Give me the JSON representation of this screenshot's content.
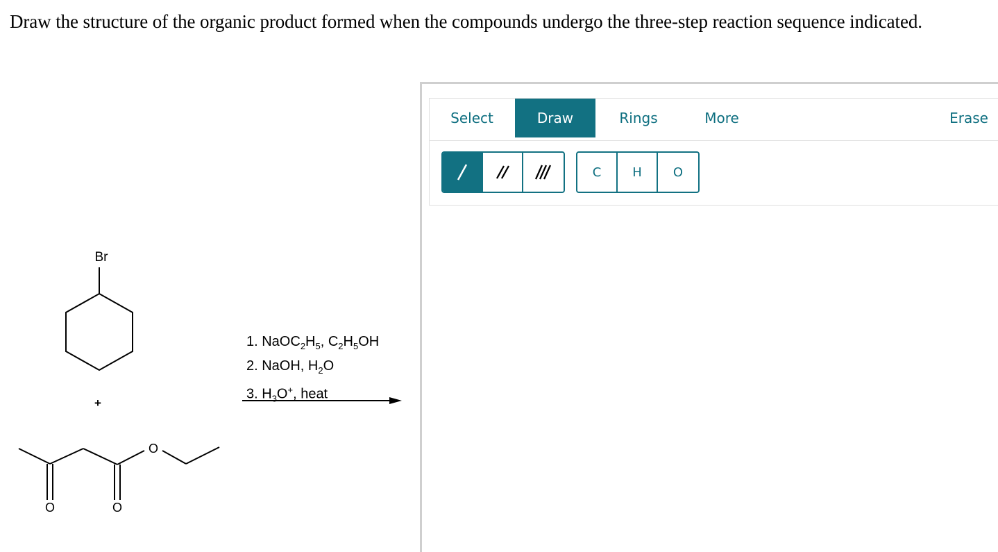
{
  "question": "Draw the structure of the organic product formed when the compounds undergo the three-step reaction sequence indicated.",
  "reactants": {
    "bromo_label": "Br",
    "plus": "+",
    "oxygen_label": "O"
  },
  "reagents": [
    {
      "step": "1. ",
      "parts": [
        "NaOC",
        "2",
        "H",
        "5",
        ", C",
        "2",
        "H",
        "5",
        "OH"
      ]
    },
    {
      "step": "2. ",
      "parts": [
        "NaOH, H",
        "2",
        "O"
      ]
    },
    {
      "step": "3. ",
      "parts": [
        "H",
        "3",
        "O",
        "+",
        ", heat"
      ]
    }
  ],
  "reagent_lines": {
    "line1_a": "1. NaOC",
    "line1_b": "2",
    "line1_c": "H",
    "line1_d": "5",
    "line1_e": ", C",
    "line1_f": "2",
    "line1_g": "H",
    "line1_h": "5",
    "line1_i": "OH",
    "line2_a": "2. NaOH, H",
    "line2_b": "2",
    "line2_c": "O",
    "line3_a": "3. H",
    "line3_b": "3",
    "line3_c": "O",
    "line3_d": "+",
    "line3_e": ", heat"
  },
  "toolbar": {
    "tabs": [
      "Select",
      "Draw",
      "Rings",
      "More",
      "Erase"
    ],
    "active_tab": "Draw",
    "bond_tools": [
      "single-bond",
      "double-bond",
      "triple-bond"
    ],
    "atoms": [
      "C",
      "H",
      "O"
    ]
  },
  "colors": {
    "accent": "#127182",
    "tab_text": "#0e6f80",
    "panel_border": "#cfcfcf"
  }
}
